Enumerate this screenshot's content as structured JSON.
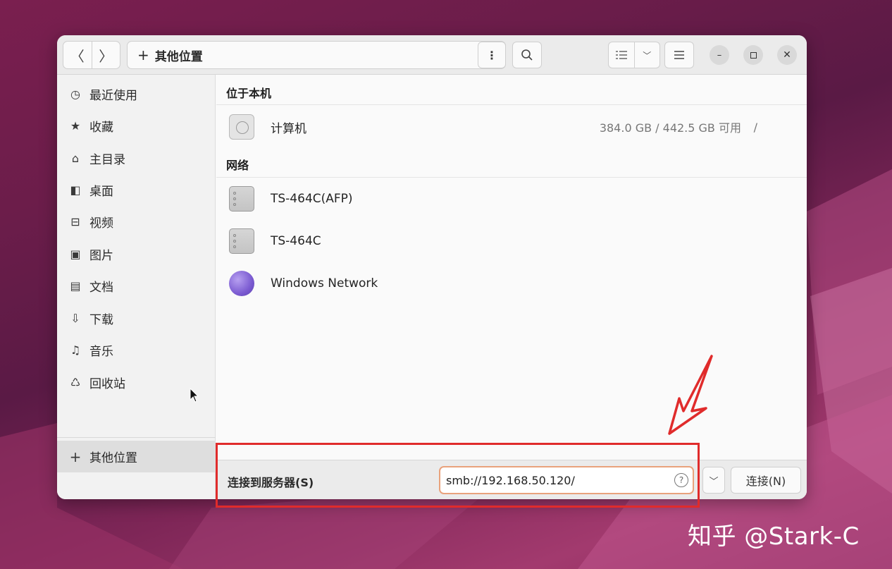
{
  "window": {
    "path_label": "其他位置",
    "path_plus": "+"
  },
  "sidebar": {
    "items": [
      {
        "label": "最近使用",
        "icon": "clock-icon"
      },
      {
        "label": "收藏",
        "icon": "star-icon"
      },
      {
        "label": "主目录",
        "icon": "home-icon"
      },
      {
        "label": "桌面",
        "icon": "desktop-icon"
      },
      {
        "label": "视频",
        "icon": "video-icon"
      },
      {
        "label": "图片",
        "icon": "picture-icon"
      },
      {
        "label": "文档",
        "icon": "document-icon"
      },
      {
        "label": "下载",
        "icon": "download-icon"
      },
      {
        "label": "音乐",
        "icon": "music-icon"
      },
      {
        "label": "回收站",
        "icon": "trash-icon"
      }
    ],
    "other_locations": {
      "label": "其他位置",
      "icon": "plus-icon"
    }
  },
  "main": {
    "local_heading": "位于本机",
    "computer": {
      "name": "计算机",
      "usage": "384.0 GB / 442.5 GB 可用",
      "mount": "/"
    },
    "network_heading": "网络",
    "network_items": [
      {
        "name": "TS-464C(AFP)",
        "icon": "server-icon"
      },
      {
        "name": "TS-464C",
        "icon": "server-icon"
      },
      {
        "name": "Windows Network",
        "icon": "network-globe-icon"
      }
    ]
  },
  "connect_bar": {
    "label": "连接到服务器(S)",
    "server_address": "smb://192.168.50.120/",
    "connect_label": "连接(N)"
  },
  "watermark": "知乎 @Stark-C",
  "colors": {
    "annotation_red": "#e02b2b",
    "input_focus": "#e9a27c"
  }
}
